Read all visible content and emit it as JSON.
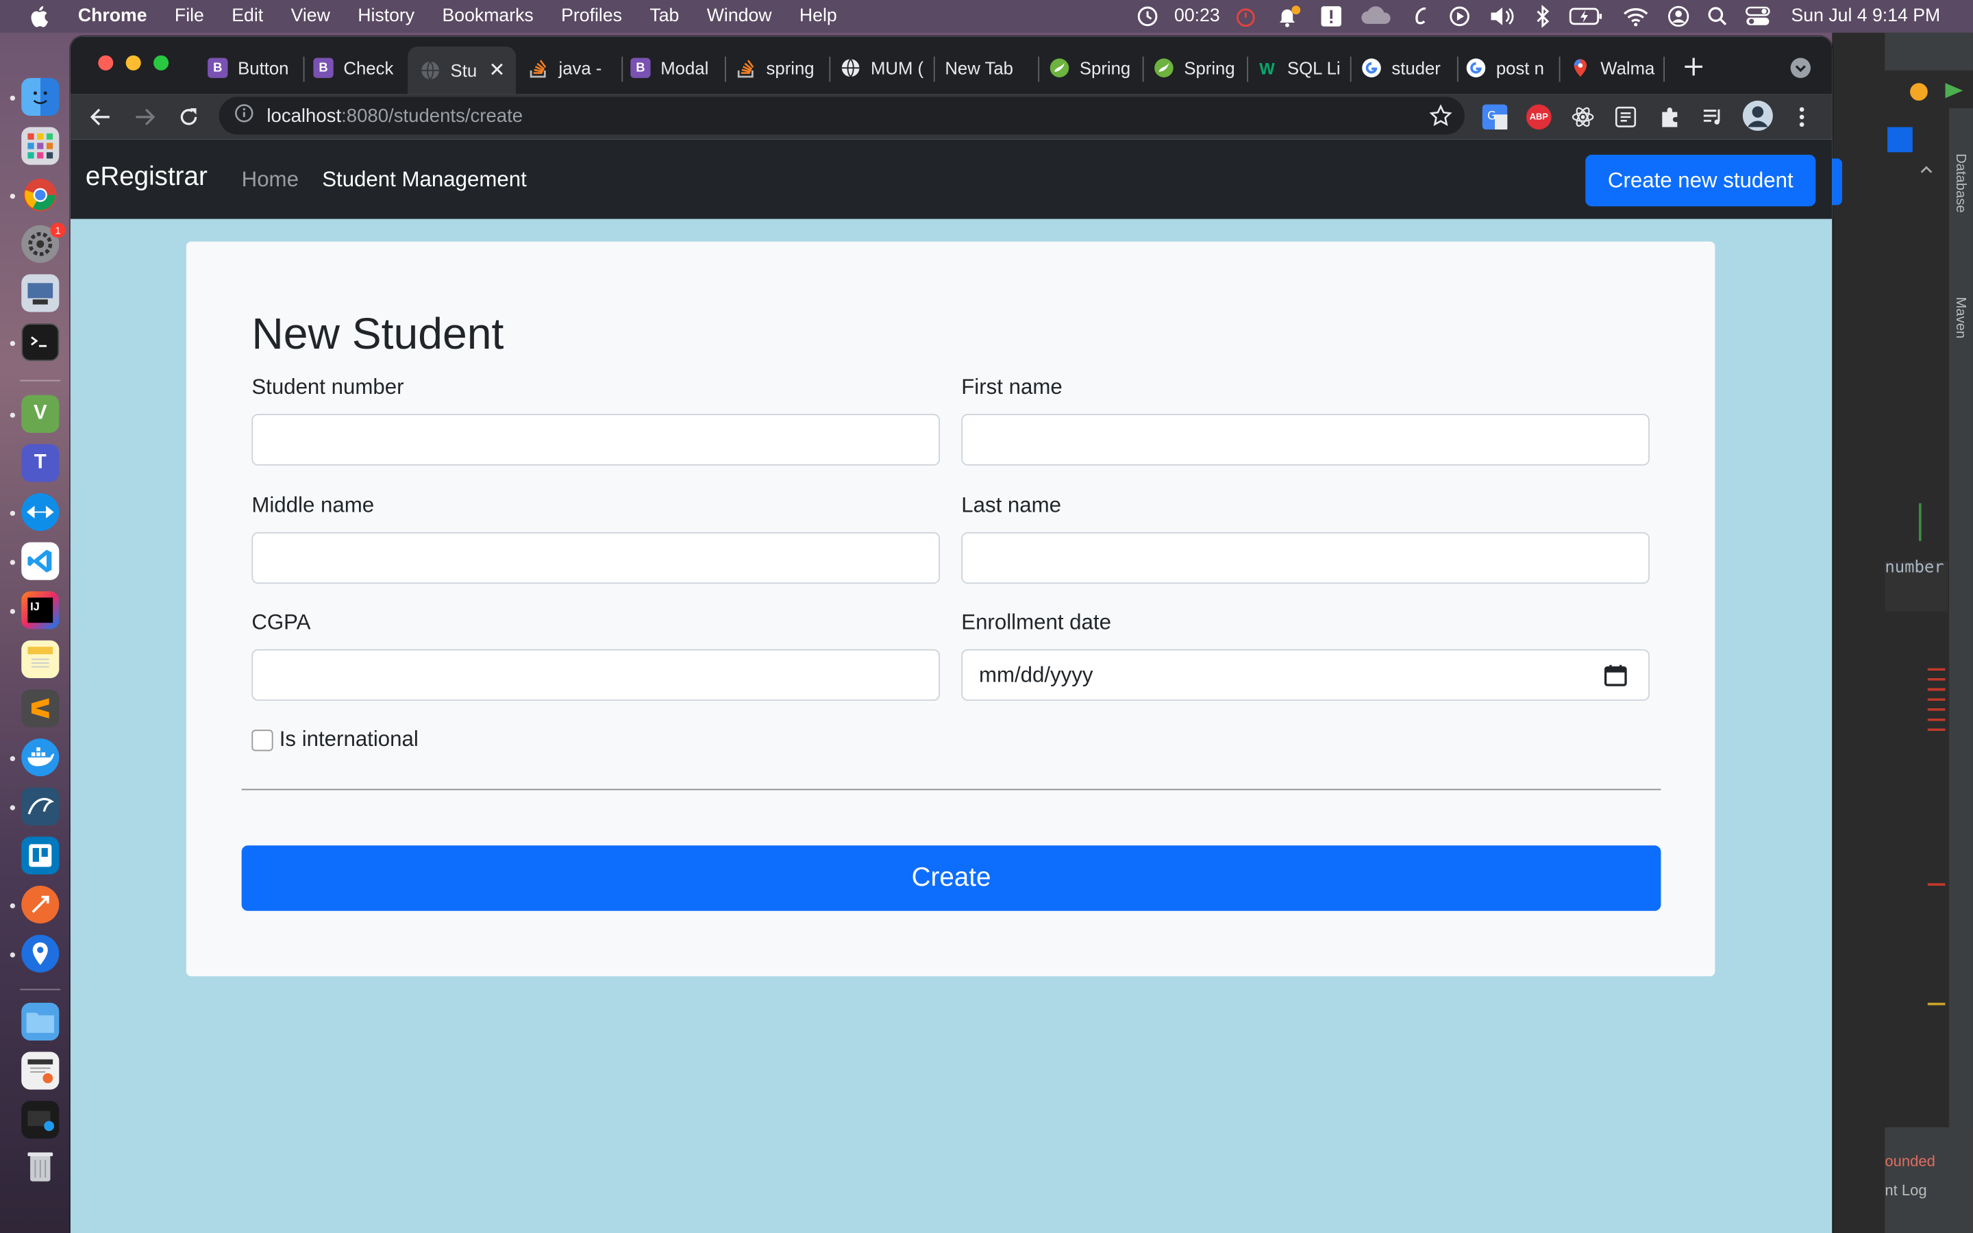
{
  "menubar": {
    "app_name": "Chrome",
    "menus": [
      "File",
      "Edit",
      "View",
      "History",
      "Bookmarks",
      "Profiles",
      "Tab",
      "Window",
      "Help"
    ],
    "timer": "00:23",
    "clock": "Sun Jul 4  9:14 PM"
  },
  "browser": {
    "tabs": [
      {
        "label": "Button",
        "favicon": "bootstrap-icon"
      },
      {
        "label": "Check",
        "favicon": "bootstrap-icon"
      },
      {
        "label": "Stu",
        "favicon": "globe-icon",
        "active": true
      },
      {
        "label": "java - ",
        "favicon": "stackoverflow-icon"
      },
      {
        "label": "Modal",
        "favicon": "bootstrap-icon"
      },
      {
        "label": "spring",
        "favicon": "stackoverflow-icon"
      },
      {
        "label": "MUM (",
        "favicon": "globe-icon"
      },
      {
        "label": "New Tab",
        "favicon": "none"
      },
      {
        "label": "Spring",
        "favicon": "spring-icon"
      },
      {
        "label": "Spring",
        "favicon": "spring-icon"
      },
      {
        "label": "SQL Li",
        "favicon": "w3schools-icon"
      },
      {
        "label": "studer",
        "favicon": "google-icon"
      },
      {
        "label": "post n",
        "favicon": "google-icon"
      },
      {
        "label": "Walma",
        "favicon": "maps-icon"
      }
    ],
    "url_host": "localhost",
    "url_rest": ":8080/students/create",
    "extension_labels": {
      "abp": "ABP"
    }
  },
  "navbar": {
    "brand": "eRegistrar",
    "links": [
      "Home",
      "Student Management"
    ],
    "create_button": "Create new student"
  },
  "form": {
    "title": "New Student",
    "student_number_label": "Student number",
    "first_name_label": "First name",
    "middle_name_label": "Middle name",
    "last_name_label": "Last name",
    "cgpa_label": "CGPA",
    "enrollment_date_label": "Enrollment date",
    "enrollment_date_placeholder": "mm/dd/yyyy",
    "is_international_label": "Is international",
    "submit_label": "Create"
  },
  "ide": {
    "tool_windows": [
      "Database",
      "Maven"
    ],
    "code_fragment": "number",
    "status_fragment_1": "ounded",
    "status_fragment_2": "nt Log"
  },
  "colors": {
    "page_background": "#add8e6",
    "primary": "#0d6efd",
    "navbar": "#212529"
  }
}
